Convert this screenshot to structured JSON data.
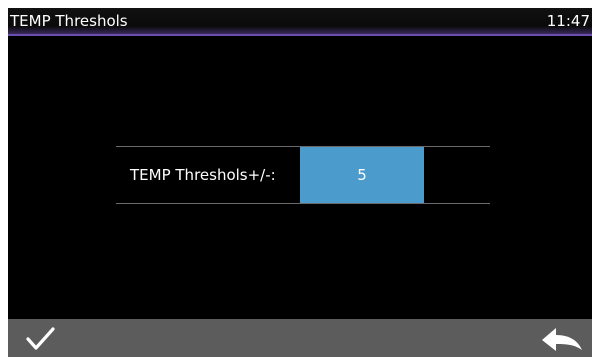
{
  "header": {
    "title": "TEMP Threshols",
    "clock": "11:47"
  },
  "setting": {
    "label": "TEMP Threshols+/-:",
    "value": "5"
  },
  "footer": {
    "confirm_icon": "checkmark-icon",
    "back_icon": "return-arrow-icon"
  },
  "colors": {
    "background": "#000000",
    "title_accent": "#6a4fb0",
    "value_highlight": "#4b9ccc",
    "bottom_bar": "#5c5c5c"
  }
}
